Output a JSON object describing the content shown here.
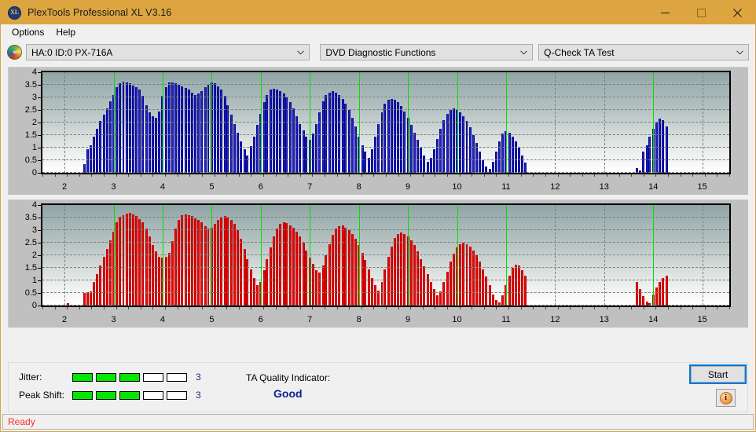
{
  "window": {
    "title": "PlexTools Professional XL V3.16",
    "app_icon": "xl-disc-icon",
    "minimize": "minimize-icon",
    "maximize": "maximize-icon",
    "close": "close-icon"
  },
  "menu": {
    "items": [
      "Options",
      "Help"
    ]
  },
  "toolbar": {
    "drive_icon": "disc-icon",
    "drive": {
      "value": "HA:0 ID:0  PX-716A"
    },
    "function": {
      "value": "DVD Diagnostic Functions"
    },
    "test": {
      "value": "Q-Check TA Test"
    }
  },
  "bottom": {
    "jitter_label": "Jitter:",
    "jitter_value": "3",
    "jitter_segments_on": 3,
    "jitter_segments_total": 5,
    "peakshift_label": "Peak Shift:",
    "peakshift_value": "3",
    "peakshift_segments_on": 3,
    "peakshift_segments_total": 5,
    "tqi_label": "TA Quality Indicator:",
    "tqi_value": "Good",
    "start_label": "Start",
    "info_label": "i",
    "colors": {
      "meter_on": "#00e800",
      "tqi": "#0a1f8f",
      "accent": "#dca53f"
    }
  },
  "status": {
    "text": "Ready",
    "color": "#ff2a2a"
  },
  "chart_data": [
    {
      "id": "jitter-chart",
      "type": "bar",
      "title": "",
      "xlabel": "",
      "ylabel": "",
      "color": "#1f1fd0",
      "edge_color": "#0a0a8c",
      "ylim": [
        0,
        4
      ],
      "yticks": [
        0,
        0.5,
        1,
        1.5,
        2,
        2.5,
        3,
        3.5,
        4
      ],
      "xlim": [
        1.55,
        15.55
      ],
      "xticks": [
        2,
        3,
        4,
        5,
        6,
        7,
        8,
        9,
        10,
        11,
        12,
        13,
        14,
        15
      ],
      "grid": true,
      "markers": [
        3,
        4,
        5,
        6,
        7,
        8,
        9,
        10,
        11,
        14
      ],
      "marker_color": "#00e000",
      "bar_step": 0.0667,
      "x": [
        2.4,
        2.47,
        2.53,
        2.6,
        2.67,
        2.73,
        2.8,
        2.87,
        2.93,
        3.0,
        3.07,
        3.13,
        3.2,
        3.27,
        3.33,
        3.4,
        3.47,
        3.53,
        3.6,
        3.67,
        3.73,
        3.8,
        3.87,
        3.93,
        4.0,
        4.07,
        4.13,
        4.2,
        4.27,
        4.33,
        4.4,
        4.47,
        4.53,
        4.6,
        4.67,
        4.73,
        4.8,
        4.87,
        4.93,
        5.0,
        5.07,
        5.13,
        5.2,
        5.27,
        5.33,
        5.4,
        5.47,
        5.53,
        5.6,
        5.67,
        5.73,
        5.8,
        5.87,
        5.93,
        6.0,
        6.07,
        6.13,
        6.2,
        6.27,
        6.33,
        6.4,
        6.47,
        6.53,
        6.6,
        6.67,
        6.73,
        6.8,
        6.87,
        6.93,
        7.0,
        7.07,
        7.13,
        7.2,
        7.27,
        7.33,
        7.4,
        7.47,
        7.53,
        7.6,
        7.67,
        7.73,
        7.8,
        7.87,
        7.93,
        8.0,
        8.07,
        8.13,
        8.2,
        8.27,
        8.33,
        8.4,
        8.47,
        8.53,
        8.6,
        8.67,
        8.73,
        8.8,
        8.87,
        8.93,
        9.0,
        9.07,
        9.13,
        9.2,
        9.27,
        9.33,
        9.4,
        9.47,
        9.53,
        9.6,
        9.67,
        9.73,
        9.8,
        9.87,
        9.93,
        10.0,
        10.07,
        10.13,
        10.2,
        10.27,
        10.33,
        10.4,
        10.47,
        10.53,
        10.6,
        10.67,
        10.73,
        10.8,
        10.87,
        10.93,
        11.0,
        11.07,
        11.13,
        11.2,
        11.27,
        11.33,
        11.4,
        13.67,
        13.73,
        13.8,
        13.87,
        13.93,
        14.0,
        14.07,
        14.13,
        14.2,
        14.27
      ],
      "values": [
        0.35,
        0.95,
        1.1,
        1.45,
        1.75,
        2.05,
        2.3,
        2.55,
        2.85,
        3.1,
        3.4,
        3.55,
        3.62,
        3.6,
        3.55,
        3.48,
        3.4,
        3.3,
        3.05,
        2.7,
        2.4,
        2.25,
        2.2,
        2.45,
        3.05,
        3.4,
        3.58,
        3.6,
        3.55,
        3.5,
        3.45,
        3.38,
        3.3,
        3.2,
        3.1,
        3.15,
        3.25,
        3.4,
        3.52,
        3.58,
        3.55,
        3.45,
        3.3,
        3.05,
        2.7,
        2.3,
        1.95,
        1.6,
        1.25,
        0.95,
        0.7,
        1.05,
        1.45,
        1.9,
        2.35,
        2.8,
        3.1,
        3.3,
        3.35,
        3.3,
        3.25,
        3.15,
        3.0,
        2.8,
        2.55,
        2.25,
        1.95,
        1.7,
        1.45,
        1.3,
        1.55,
        1.95,
        2.4,
        2.85,
        3.1,
        3.2,
        3.25,
        3.2,
        3.1,
        2.95,
        2.75,
        2.5,
        2.2,
        1.85,
        1.45,
        1.1,
        0.85,
        0.6,
        0.95,
        1.45,
        1.95,
        2.4,
        2.75,
        2.9,
        2.95,
        2.9,
        2.8,
        2.65,
        2.45,
        2.2,
        1.9,
        1.6,
        1.3,
        1.0,
        0.7,
        0.45,
        0.6,
        0.95,
        1.35,
        1.75,
        2.1,
        2.35,
        2.5,
        2.55,
        2.5,
        2.4,
        2.25,
        2.05,
        1.8,
        1.5,
        1.2,
        0.85,
        0.5,
        0.25,
        0.15,
        0.45,
        0.85,
        1.25,
        1.55,
        1.65,
        1.6,
        1.45,
        1.25,
        1.0,
        0.7,
        0.4,
        0.18,
        0.1,
        0.85,
        1.1,
        1.45,
        1.75,
        2.0,
        2.15,
        2.1,
        1.85,
        1.4,
        0.95
      ]
    },
    {
      "id": "peakshift-chart",
      "type": "bar",
      "title": "",
      "xlabel": "",
      "ylabel": "",
      "color": "#f00000",
      "edge_color": "#c00000",
      "ylim": [
        0,
        4
      ],
      "yticks": [
        0,
        0.5,
        1,
        1.5,
        2,
        2.5,
        3,
        3.5,
        4
      ],
      "xlim": [
        1.55,
        15.55
      ],
      "xticks": [
        2,
        3,
        4,
        5,
        6,
        7,
        8,
        9,
        10,
        11,
        12,
        13,
        14,
        15
      ],
      "grid": true,
      "markers": [
        3,
        4,
        5,
        6,
        7,
        8,
        9,
        10,
        11,
        14
      ],
      "marker_color": "#00e000",
      "bar_step": 0.0667,
      "x": [
        2.07,
        2.4,
        2.47,
        2.53,
        2.6,
        2.67,
        2.73,
        2.8,
        2.87,
        2.93,
        3.0,
        3.07,
        3.13,
        3.2,
        3.27,
        3.33,
        3.4,
        3.47,
        3.53,
        3.6,
        3.67,
        3.73,
        3.8,
        3.87,
        3.93,
        4.0,
        4.07,
        4.13,
        4.2,
        4.27,
        4.33,
        4.4,
        4.47,
        4.53,
        4.6,
        4.67,
        4.73,
        4.8,
        4.87,
        4.93,
        5.0,
        5.07,
        5.13,
        5.2,
        5.27,
        5.33,
        5.4,
        5.47,
        5.53,
        5.6,
        5.67,
        5.73,
        5.8,
        5.87,
        5.93,
        6.0,
        6.07,
        6.13,
        6.2,
        6.27,
        6.33,
        6.4,
        6.47,
        6.53,
        6.6,
        6.67,
        6.73,
        6.8,
        6.87,
        6.93,
        7.0,
        7.07,
        7.13,
        7.2,
        7.27,
        7.33,
        7.4,
        7.47,
        7.53,
        7.6,
        7.67,
        7.73,
        7.8,
        7.87,
        7.93,
        8.0,
        8.07,
        8.13,
        8.2,
        8.27,
        8.33,
        8.4,
        8.47,
        8.53,
        8.6,
        8.67,
        8.73,
        8.8,
        8.87,
        8.93,
        9.0,
        9.07,
        9.13,
        9.2,
        9.27,
        9.33,
        9.4,
        9.47,
        9.53,
        9.6,
        9.67,
        9.73,
        9.8,
        9.87,
        9.93,
        10.0,
        10.07,
        10.13,
        10.2,
        10.27,
        10.33,
        10.4,
        10.47,
        10.53,
        10.6,
        10.67,
        10.73,
        10.8,
        10.87,
        10.93,
        11.0,
        11.07,
        11.13,
        11.2,
        11.27,
        11.33,
        11.4,
        13.67,
        13.73,
        13.8,
        13.87,
        13.93,
        14.0,
        14.07,
        14.13,
        14.2,
        14.27
      ],
      "values": [
        0.1,
        0.5,
        0.52,
        0.55,
        0.95,
        1.25,
        1.6,
        1.95,
        2.25,
        2.6,
        2.95,
        3.3,
        3.52,
        3.6,
        3.65,
        3.68,
        3.62,
        3.55,
        3.45,
        3.3,
        3.05,
        2.75,
        2.4,
        2.15,
        1.95,
        1.9,
        1.95,
        2.1,
        2.55,
        3.05,
        3.4,
        3.58,
        3.62,
        3.6,
        3.55,
        3.48,
        3.4,
        3.3,
        3.15,
        3.05,
        3.1,
        3.25,
        3.4,
        3.5,
        3.55,
        3.5,
        3.4,
        3.25,
        3.0,
        2.65,
        2.25,
        1.85,
        1.45,
        1.1,
        0.8,
        0.95,
        1.4,
        1.85,
        2.3,
        2.75,
        3.05,
        3.25,
        3.3,
        3.28,
        3.2,
        3.1,
        2.95,
        2.75,
        2.5,
        2.2,
        1.9,
        1.65,
        1.4,
        1.3,
        1.6,
        2.0,
        2.45,
        2.8,
        3.05,
        3.15,
        3.18,
        3.1,
        3.0,
        2.85,
        2.65,
        2.4,
        2.1,
        1.8,
        1.45,
        1.1,
        0.8,
        0.6,
        0.95,
        1.45,
        1.95,
        2.35,
        2.7,
        2.85,
        2.9,
        2.85,
        2.75,
        2.6,
        2.4,
        2.15,
        1.85,
        1.55,
        1.25,
        0.95,
        0.65,
        0.4,
        0.55,
        0.95,
        1.35,
        1.75,
        2.05,
        2.3,
        2.45,
        2.5,
        2.45,
        2.35,
        2.2,
        2.0,
        1.75,
        1.45,
        1.15,
        0.8,
        0.45,
        0.22,
        0.12,
        0.4,
        0.8,
        1.2,
        1.5,
        1.62,
        1.58,
        1.42,
        1.2,
        0.95,
        0.65,
        0.38,
        0.15,
        0.08,
        0.45,
        0.72,
        0.95,
        1.1,
        1.2,
        1.25,
        1.18,
        0.95,
        0.72,
        0.5
      ]
    }
  ]
}
